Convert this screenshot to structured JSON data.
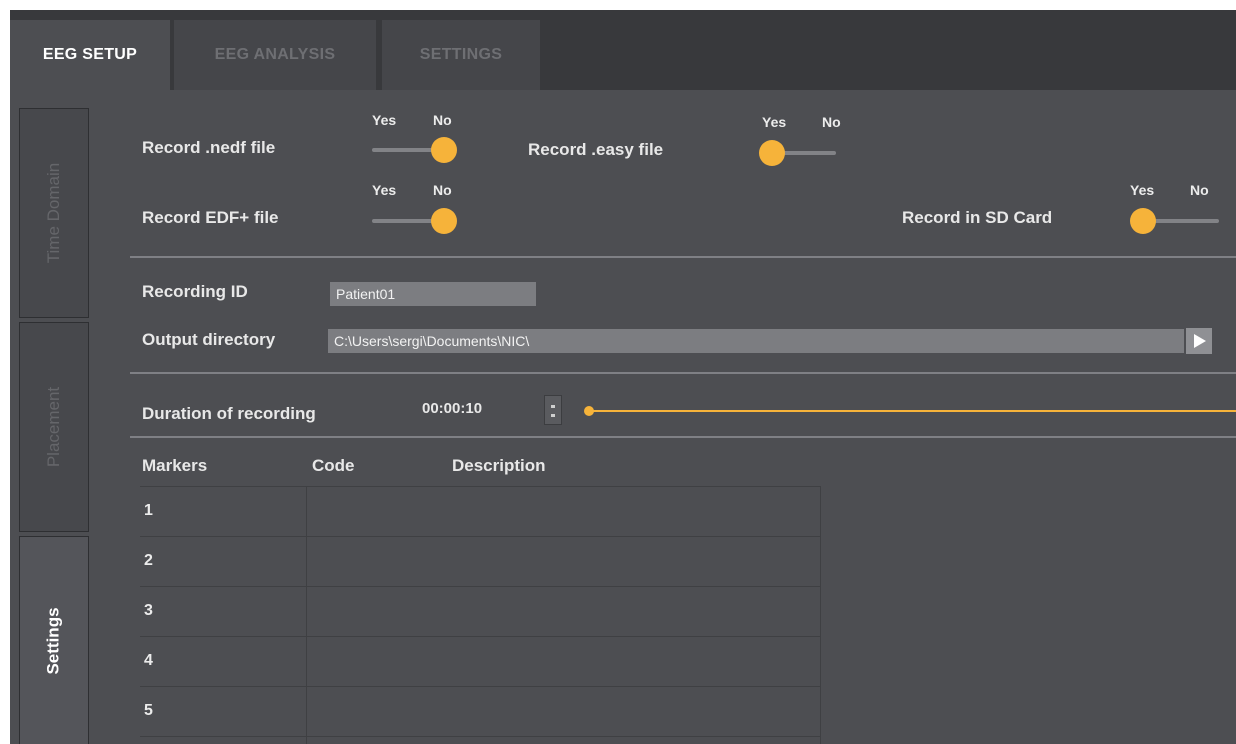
{
  "tabs": {
    "eeg_setup": "EEG SETUP",
    "eeg_analysis": "EEG ANALYSIS",
    "settings": "SETTINGS"
  },
  "side_tabs": {
    "time_domain": "Time Domain",
    "placement": "Placement",
    "settings": "Settings"
  },
  "options": {
    "yes": "Yes",
    "no": "No",
    "record_nedf": {
      "label": "Record .nedf file",
      "value": "No"
    },
    "record_easy": {
      "label": "Record .easy file",
      "value": "Yes"
    },
    "record_edf": {
      "label": "Record EDF+ file",
      "value": "No"
    },
    "record_sd": {
      "label": "Record in SD Card",
      "value": "Yes"
    }
  },
  "recording": {
    "id_label": "Recording ID",
    "id_value": "Patient01",
    "dir_label": "Output directory",
    "dir_value": "C:\\Users\\sergi\\Documents\\NIC\\",
    "duration_label": "Duration of recording",
    "duration_value": "00:00:10"
  },
  "markers": {
    "headers": [
      "Markers",
      "Code",
      "Description"
    ],
    "rows": [
      "1",
      "2",
      "3",
      "4",
      "5"
    ]
  },
  "colors": {
    "accent": "#f6b33a",
    "background": "#4d4e52",
    "tabbar": "#38393c"
  }
}
